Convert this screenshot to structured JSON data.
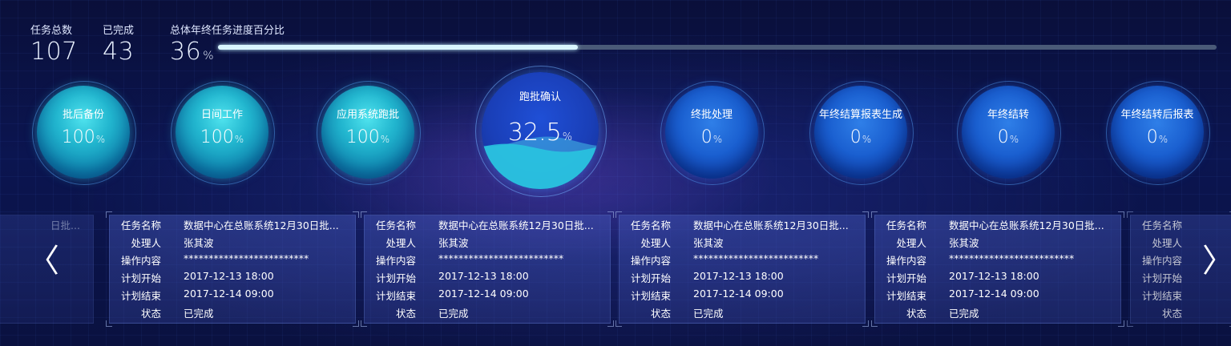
{
  "summary": {
    "total_label": "任务总数",
    "total_value": "107",
    "done_label": "已完成",
    "done_value": "43",
    "progress_label": "总体年终任务进度百分比",
    "progress_value": "36",
    "progress_unit": "%",
    "progress_fraction": 0.36
  },
  "stages": [
    {
      "name": "批后备份",
      "value": "100",
      "unit": "%",
      "fill": 1.0
    },
    {
      "name": "日间工作",
      "value": "100",
      "unit": "%",
      "fill": 1.0
    },
    {
      "name": "应用系统跑批",
      "value": "100",
      "unit": "%",
      "fill": 1.0
    },
    {
      "name": "跑批确认",
      "value": "32.5",
      "unit": "%",
      "fill": 0.325
    },
    {
      "name": "终批处理",
      "value": "0",
      "unit": "%",
      "fill": 0
    },
    {
      "name": "年终结算报表生成",
      "value": "0",
      "unit": "%",
      "fill": 0
    },
    {
      "name": "年终结转",
      "value": "0",
      "unit": "%",
      "fill": 0
    },
    {
      "name": "年终结转后报表",
      "value": "0",
      "unit": "%",
      "fill": 0
    }
  ],
  "field_labels": {
    "task_name": "任务名称",
    "handler": "处理人",
    "operation": "操作内容",
    "plan_start": "计划开始",
    "plan_end": "计划结束",
    "status": "状态"
  },
  "partial_left_card_text": "日批...",
  "tasks": [
    {
      "task_name": "数据中心在总账系统12月30日批...",
      "handler": "张其波",
      "operation": "*************************",
      "plan_start": "2017-12-13  18:00",
      "plan_end": "2017-12-14  09:00",
      "status": "已完成"
    },
    {
      "task_name": "数据中心在总账系统12月30日批...",
      "handler": "张其波",
      "operation": "*************************",
      "plan_start": "2017-12-13  18:00",
      "plan_end": "2017-12-14  09:00",
      "status": "已完成"
    },
    {
      "task_name": "数据中心在总账系统12月30日批...",
      "handler": "张其波",
      "operation": "*************************",
      "plan_start": "2017-12-13  18:00",
      "plan_end": "2017-12-14  09:00",
      "status": "已完成"
    },
    {
      "task_name": "数据中心在总账系统12月30日批...",
      "handler": "张其波",
      "operation": "*************************",
      "plan_start": "2017-12-13  18:00",
      "plan_end": "2017-12-14  09:00",
      "status": "已完成"
    }
  ],
  "nav": {
    "prev_icon": "chevron-left-icon",
    "prev_glyph": "〈",
    "next_icon": "chevron-right-icon",
    "next_glyph": "〉"
  }
}
